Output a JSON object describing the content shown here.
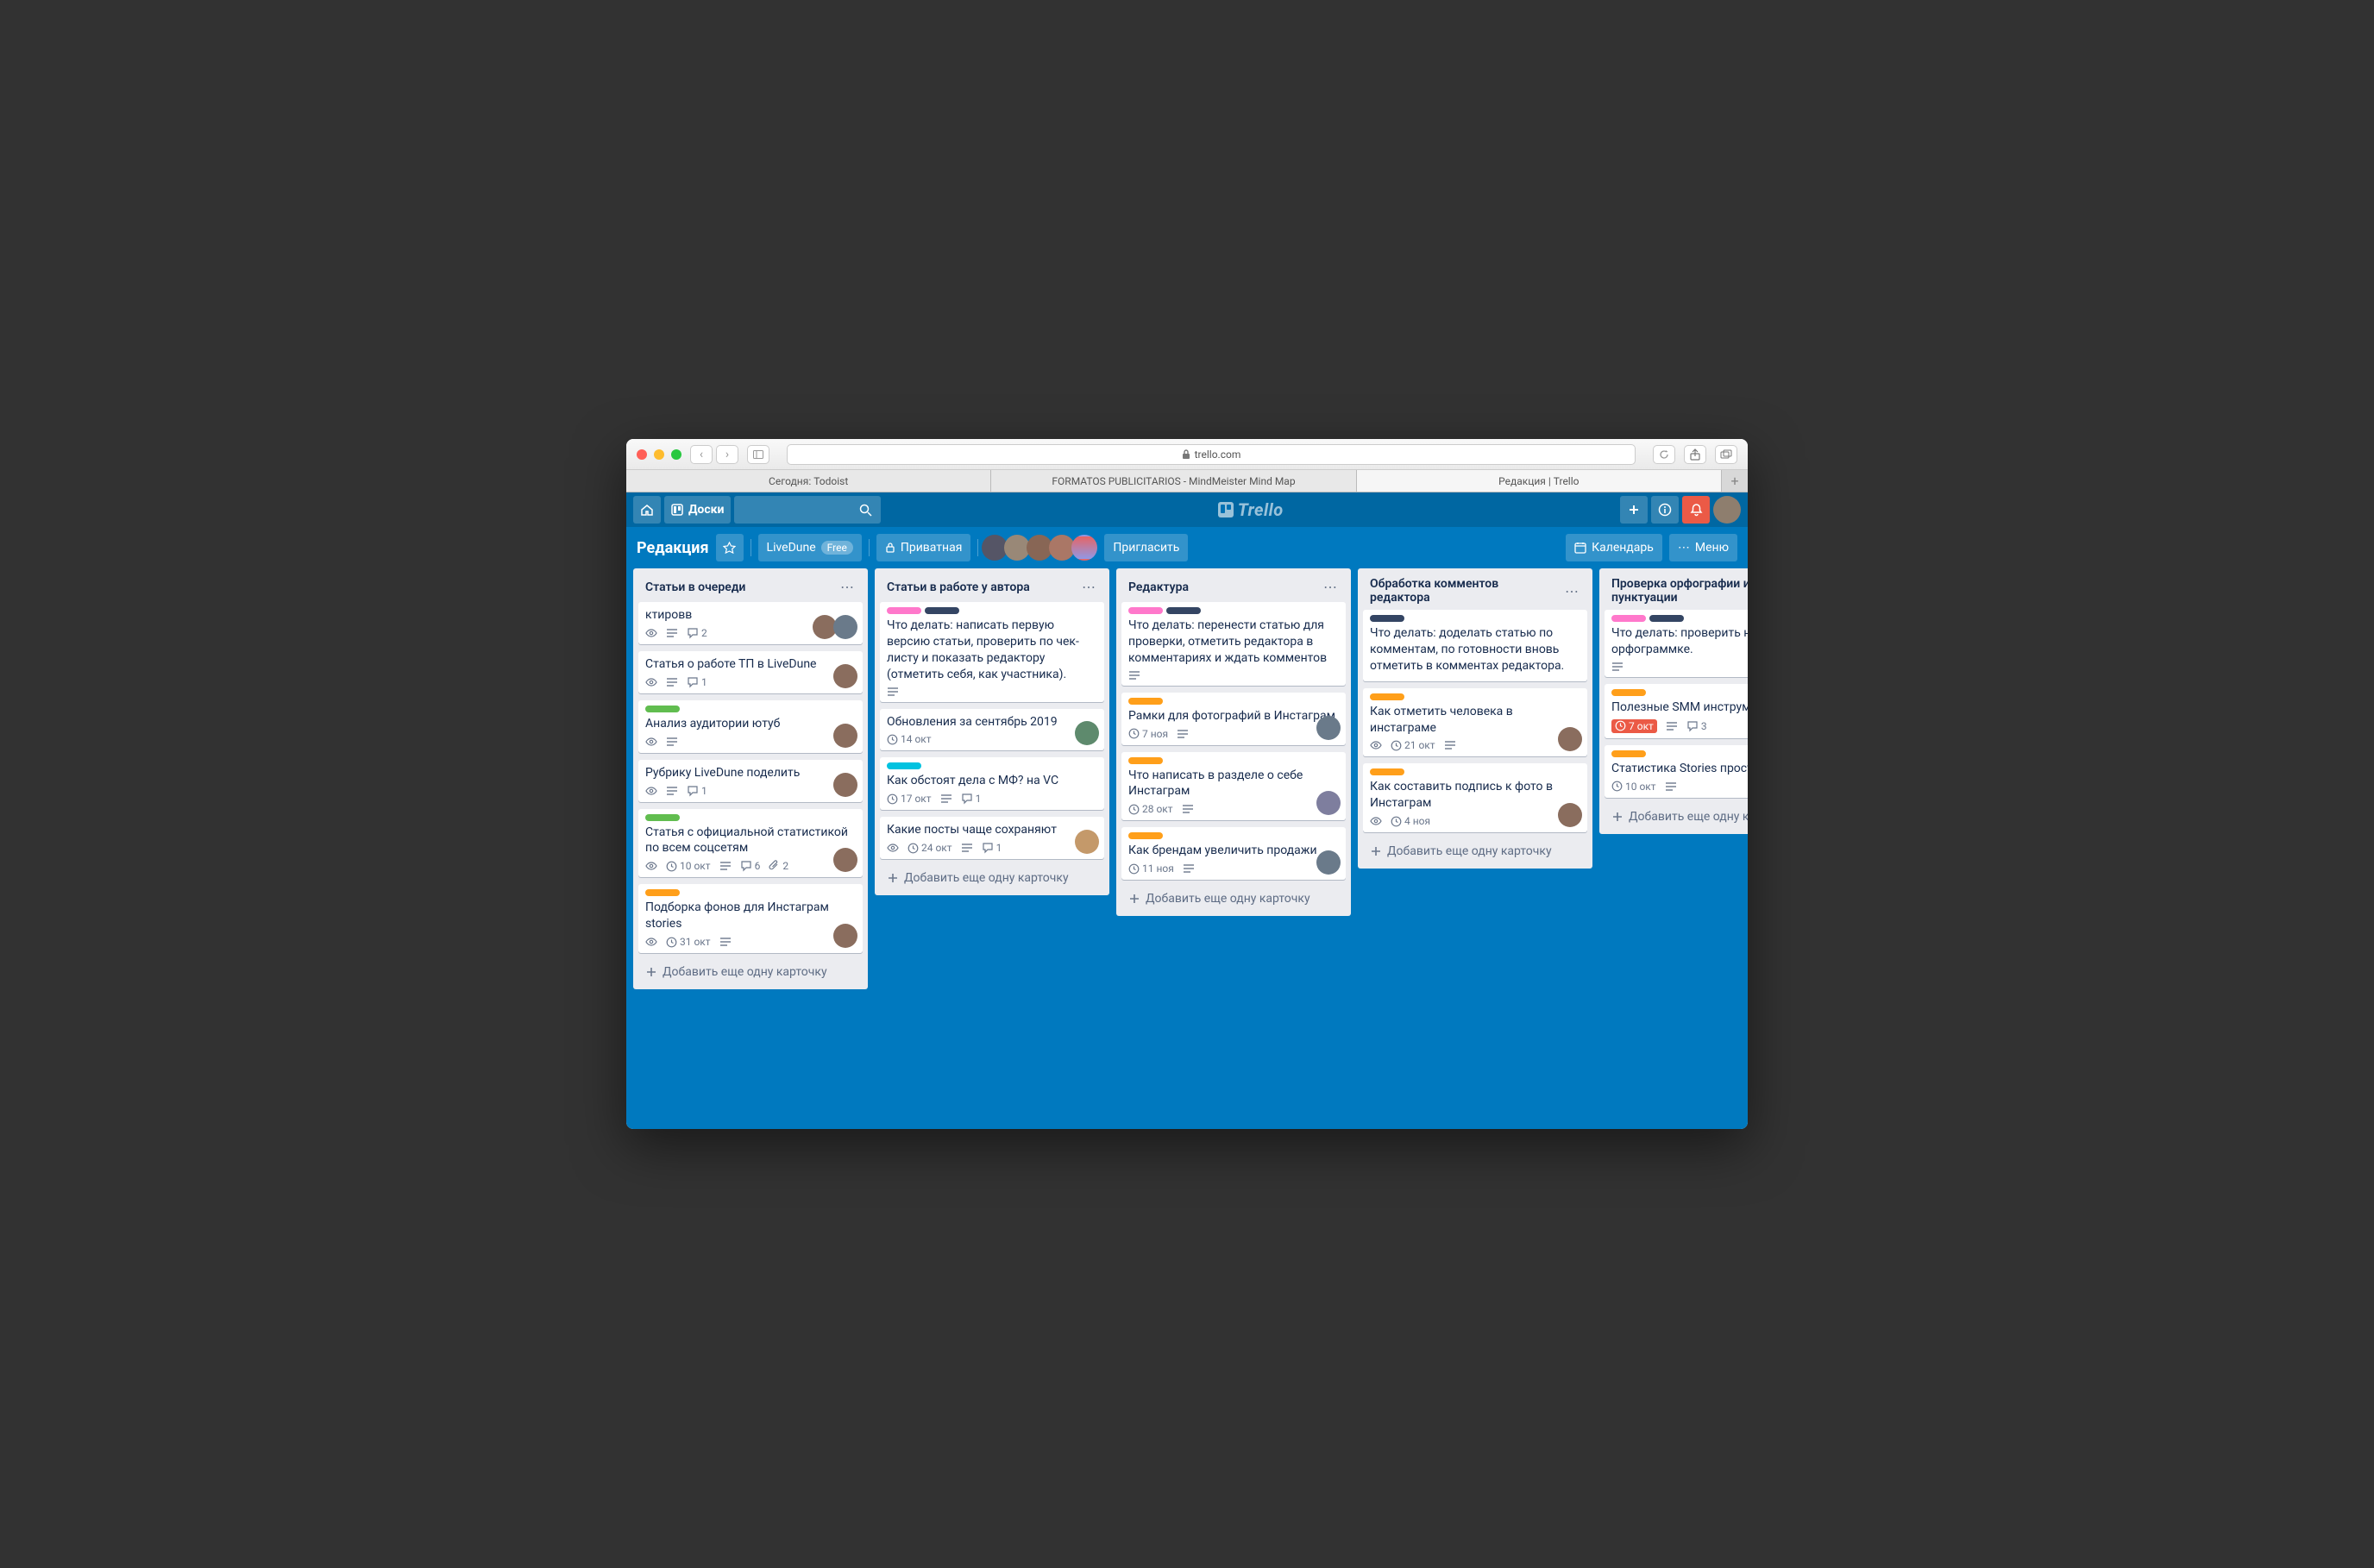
{
  "browser": {
    "url_host": "trello.com",
    "tabs": [
      {
        "label": "Сегодня: Todoist"
      },
      {
        "label": "FORMATOS PUBLICITARIOS - MindMeister Mind Map"
      },
      {
        "label": "Редакция | Trello"
      }
    ]
  },
  "header": {
    "boards_btn": "Доски",
    "logo_text": "Trello"
  },
  "board": {
    "title": "Редакция",
    "team_name": "LiveDune",
    "team_badge": "Free",
    "visibility": "Приватная",
    "invite": "Пригласить",
    "calendar": "Календарь",
    "menu": "Меню"
  },
  "add_card_label": "Добавить еще одну карточку",
  "lists": [
    {
      "title": "Статьи в очереди",
      "cards": [
        {
          "labels": [],
          "title": "ктировв",
          "badges": {
            "watch": true,
            "desc": true,
            "comments": "2"
          },
          "members": [
            "a",
            "b"
          ]
        },
        {
          "labels": [],
          "title": "Статья о работе ТП в LiveDune",
          "badges": {
            "watch": true,
            "desc": true,
            "comments": "1"
          },
          "members": [
            "a"
          ]
        },
        {
          "labels": [
            "green"
          ],
          "title": "Анализ аудитории ютуб",
          "badges": {
            "watch": true,
            "desc": true
          },
          "members": [
            "a"
          ]
        },
        {
          "labels": [],
          "title": "Рубрику LiveDune поделить",
          "badges": {
            "watch": true,
            "desc": true,
            "comments": "1"
          },
          "members": [
            "a"
          ]
        },
        {
          "labels": [
            "green"
          ],
          "title": "Статья с официальной статистикой по всем соцсетям",
          "badges": {
            "watch": true,
            "date": "10 окт",
            "desc": true,
            "comments": "6",
            "attach": "2"
          },
          "members": [
            "a"
          ]
        },
        {
          "labels": [
            "orange"
          ],
          "title": "Подборка фонов для Инстаграм stories",
          "badges": {
            "watch": true,
            "date": "31 окт",
            "desc": true
          },
          "members": [
            "a"
          ]
        }
      ]
    },
    {
      "title": "Статьи в работе у автора",
      "cards": [
        {
          "labels": [
            "pink",
            "dark"
          ],
          "title": "Что делать: написать первую версию статьи, проверить по чек-листу и показать редактору (отметить себя, как участника).",
          "badges": {
            "desc": true
          }
        },
        {
          "labels": [],
          "title": "Обновления за сентябрь 2019",
          "badges": {
            "date": "14 окт"
          },
          "members": [
            "c"
          ]
        },
        {
          "labels": [
            "sky"
          ],
          "title": "Как обстоят дела с МФ? на VC",
          "badges": {
            "date": "17 окт",
            "desc": true,
            "comments": "1"
          }
        },
        {
          "labels": [],
          "title": "Какие посты чаще сохраняют",
          "badges": {
            "watch": true,
            "date": "24 окт",
            "desc": true,
            "comments": "1"
          },
          "members": [
            "d"
          ]
        }
      ]
    },
    {
      "title": "Редактура",
      "cards": [
        {
          "labels": [
            "pink",
            "dark"
          ],
          "title": "Что делать: перенести статью для проверки, отметить редактора в комментариях и ждать комментов",
          "badges": {
            "desc": true
          }
        },
        {
          "labels": [
            "orange"
          ],
          "title": "Рамки для фотографий в Инстаграм",
          "badges": {
            "date": "7 ноя",
            "desc": true
          },
          "members": [
            "b"
          ]
        },
        {
          "labels": [
            "orange"
          ],
          "title": "Что написать в разделе о себе Инстаграм",
          "badges": {
            "date": "28 окт",
            "desc": true
          },
          "members": [
            "e"
          ]
        },
        {
          "labels": [
            "orange"
          ],
          "title": "Как брендам увеличить продажи",
          "badges": {
            "date": "11 ноя",
            "desc": true
          },
          "members": [
            "b"
          ]
        }
      ]
    },
    {
      "title": "Обработка комментов редактора",
      "cards": [
        {
          "labels": [
            "dark"
          ],
          "title": "Что делать: доделать статью по комментам, по готовности вновь отметить в комментах редактора."
        },
        {
          "labels": [
            "orange"
          ],
          "title": "Как отметить человека в инстаграме",
          "badges": {
            "watch": true,
            "date": "21 окт",
            "desc": true
          },
          "members": [
            "a"
          ]
        },
        {
          "labels": [
            "orange"
          ],
          "title": "Как составить подпись к фото в Инстаграм",
          "badges": {
            "watch": true,
            "date": "4 ноя"
          },
          "members": [
            "a"
          ]
        }
      ]
    },
    {
      "title": "Проверка орфографии и пунктуации",
      "cards": [
        {
          "labels": [
            "pink",
            "dark"
          ],
          "title": "Что делать: проверить на орфограммке.",
          "badges": {
            "desc": true
          }
        },
        {
          "labels": [
            "orange"
          ],
          "title": "Полезные SMM инструменты",
          "badges": {
            "date_red": "7 окт",
            "desc": true,
            "comments": "3"
          }
        },
        {
          "labels": [
            "orange"
          ],
          "title": "Статистика Stories простым языком",
          "badges": {
            "date": "10 окт",
            "desc": true,
            "comments": ""
          }
        }
      ]
    }
  ]
}
